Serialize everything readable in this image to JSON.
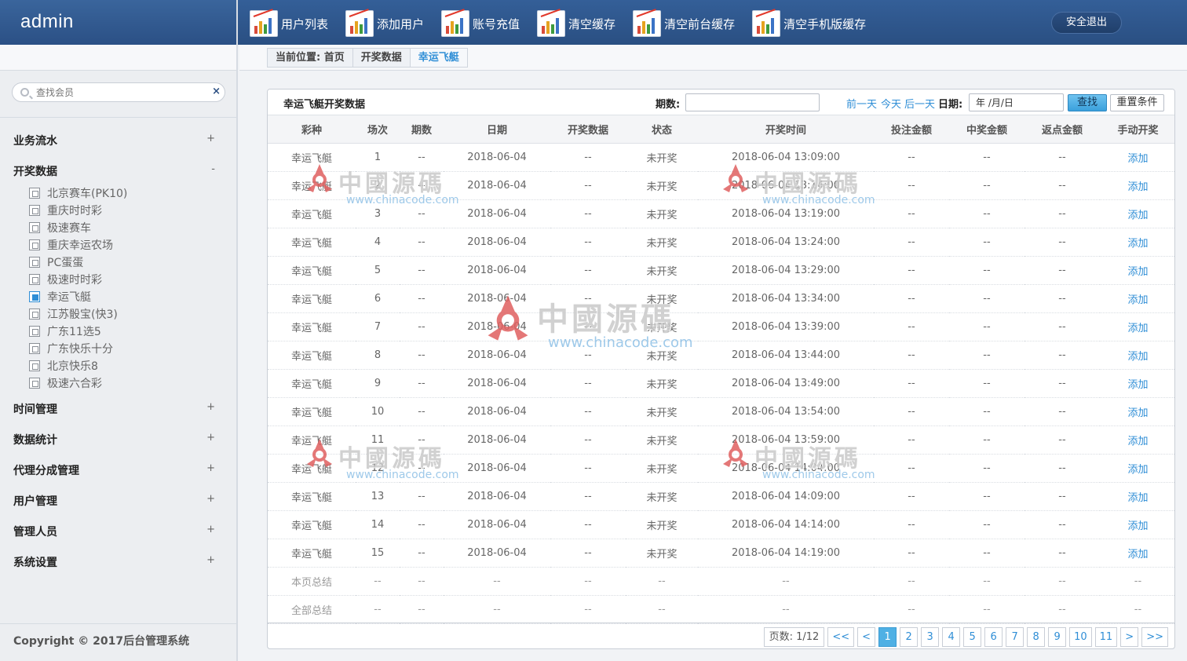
{
  "header": {
    "brand": "admin",
    "nav": [
      {
        "label": "用户列表"
      },
      {
        "label": "添加用户"
      },
      {
        "label": "账号充值"
      },
      {
        "label": "清空缓存"
      },
      {
        "label": "清空前台缓存"
      },
      {
        "label": "清空手机版缓存"
      }
    ],
    "logout": "安全退出"
  },
  "sidebar": {
    "search_placeholder": "查找会员",
    "clear": "×",
    "groups": [
      {
        "label": "业务流水",
        "toggle": "+"
      },
      {
        "label": "开奖数据",
        "toggle": "-"
      },
      {
        "label": "时间管理",
        "toggle": "+"
      },
      {
        "label": "数据统计",
        "toggle": "+"
      },
      {
        "label": "代理分成管理",
        "toggle": "+"
      },
      {
        "label": "用户管理",
        "toggle": "+"
      },
      {
        "label": "管理人员",
        "toggle": "+"
      },
      {
        "label": "系统设置",
        "toggle": "+"
      }
    ],
    "sub_items": [
      "北京赛车(PK10)",
      "重庆时时彩",
      "极速赛车",
      "重庆幸运农场",
      "PC蛋蛋",
      "极速时时彩",
      "幸运飞艇",
      "江苏骰宝(快3)",
      "广东11选5",
      "广东快乐十分",
      "北京快乐8",
      "极速六合彩"
    ],
    "active_sub": "幸运飞艇",
    "copyright": "Copyright © 2017后台管理系统"
  },
  "breadcrumb": {
    "prefix": "当前位置:",
    "items": [
      "首页",
      "开奖数据",
      "幸运飞艇"
    ]
  },
  "panel": {
    "title": "幸运飞艇开奖数据",
    "period_label": "期数:",
    "period_value": "",
    "prev_day": "前一天",
    "today": "今天",
    "next_day": "后一天",
    "date_label": "日期:",
    "date_value": "年 /月/日",
    "find_btn": "查找",
    "reset_btn": "重置条件"
  },
  "table": {
    "columns": [
      "彩种",
      "场次",
      "期数",
      "日期",
      "开奖数据",
      "状态",
      "开奖时间",
      "投注金额",
      "中奖金额",
      "返点金额",
      "手动开奖"
    ],
    "rows": [
      [
        "幸运飞艇",
        "1",
        "--",
        "2018-06-04",
        "--",
        "未开奖",
        "2018-06-04 13:09:00",
        "--",
        "--",
        "--",
        "添加"
      ],
      [
        "幸运飞艇",
        "2",
        "--",
        "2018-06-04",
        "--",
        "未开奖",
        "2018-06-04 13:14:00",
        "--",
        "--",
        "--",
        "添加"
      ],
      [
        "幸运飞艇",
        "3",
        "--",
        "2018-06-04",
        "--",
        "未开奖",
        "2018-06-04 13:19:00",
        "--",
        "--",
        "--",
        "添加"
      ],
      [
        "幸运飞艇",
        "4",
        "--",
        "2018-06-04",
        "--",
        "未开奖",
        "2018-06-04 13:24:00",
        "--",
        "--",
        "--",
        "添加"
      ],
      [
        "幸运飞艇",
        "5",
        "--",
        "2018-06-04",
        "--",
        "未开奖",
        "2018-06-04 13:29:00",
        "--",
        "--",
        "--",
        "添加"
      ],
      [
        "幸运飞艇",
        "6",
        "--",
        "2018-06-04",
        "--",
        "未开奖",
        "2018-06-04 13:34:00",
        "--",
        "--",
        "--",
        "添加"
      ],
      [
        "幸运飞艇",
        "7",
        "--",
        "2018-06-04",
        "--",
        "未开奖",
        "2018-06-04 13:39:00",
        "--",
        "--",
        "--",
        "添加"
      ],
      [
        "幸运飞艇",
        "8",
        "--",
        "2018-06-04",
        "--",
        "未开奖",
        "2018-06-04 13:44:00",
        "--",
        "--",
        "--",
        "添加"
      ],
      [
        "幸运飞艇",
        "9",
        "--",
        "2018-06-04",
        "--",
        "未开奖",
        "2018-06-04 13:49:00",
        "--",
        "--",
        "--",
        "添加"
      ],
      [
        "幸运飞艇",
        "10",
        "--",
        "2018-06-04",
        "--",
        "未开奖",
        "2018-06-04 13:54:00",
        "--",
        "--",
        "--",
        "添加"
      ],
      [
        "幸运飞艇",
        "11",
        "--",
        "2018-06-04",
        "--",
        "未开奖",
        "2018-06-04 13:59:00",
        "--",
        "--",
        "--",
        "添加"
      ],
      [
        "幸运飞艇",
        "12",
        "--",
        "2018-06-04",
        "--",
        "未开奖",
        "2018-06-04 14:04:00",
        "--",
        "--",
        "--",
        "添加"
      ],
      [
        "幸运飞艇",
        "13",
        "--",
        "2018-06-04",
        "--",
        "未开奖",
        "2018-06-04 14:09:00",
        "--",
        "--",
        "--",
        "添加"
      ],
      [
        "幸运飞艇",
        "14",
        "--",
        "2018-06-04",
        "--",
        "未开奖",
        "2018-06-04 14:14:00",
        "--",
        "--",
        "--",
        "添加"
      ],
      [
        "幸运飞艇",
        "15",
        "--",
        "2018-06-04",
        "--",
        "未开奖",
        "2018-06-04 14:19:00",
        "--",
        "--",
        "--",
        "添加"
      ]
    ],
    "summary_rows": [
      [
        "本页总结",
        "--",
        "--",
        "--",
        "--",
        "--",
        "--",
        "--",
        "--",
        "--",
        "--"
      ],
      [
        "全部总结",
        "--",
        "--",
        "--",
        "--",
        "--",
        "--",
        "--",
        "--",
        "--",
        "--"
      ]
    ]
  },
  "pagination": {
    "info": "页数: 1/12",
    "first": "<<",
    "prev": "<",
    "pages": [
      "1",
      "2",
      "3",
      "4",
      "5",
      "6",
      "7",
      "8",
      "9",
      "10",
      "11"
    ],
    "current": "1",
    "next": ">",
    "last": ">>"
  },
  "watermark": {
    "text": "中國源碼",
    "url": "www.chinacode.com"
  },
  "colors": {
    "header_bg": "#2f5a91",
    "accent": "#2f8ed6",
    "active_page": "#4fb0e4"
  }
}
